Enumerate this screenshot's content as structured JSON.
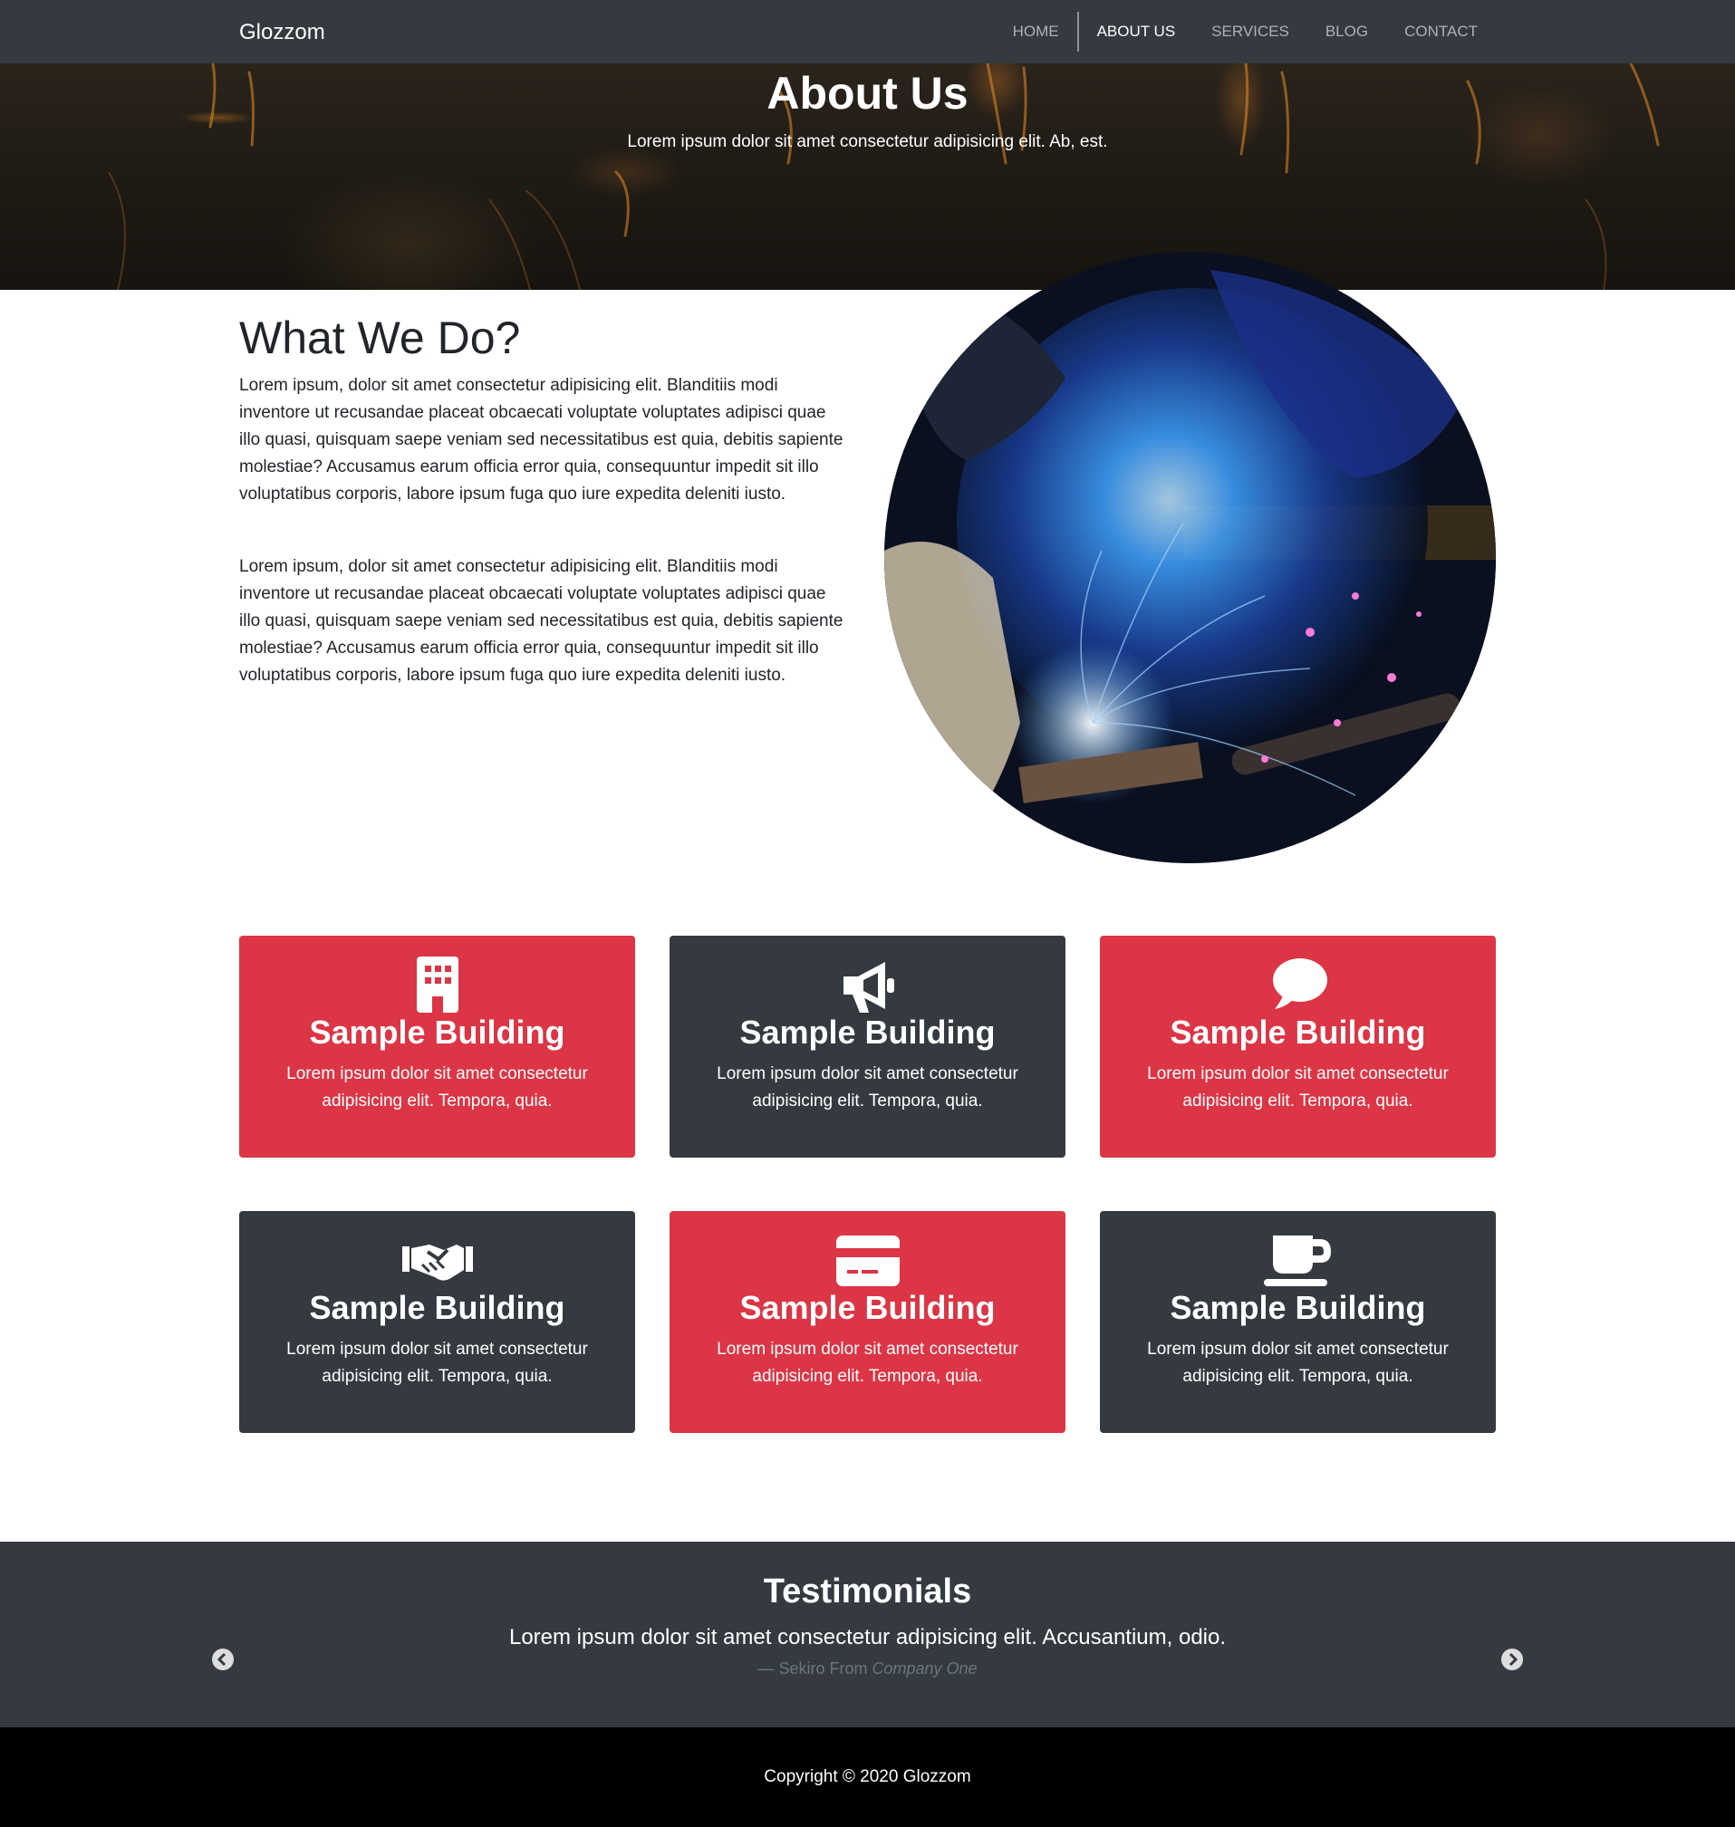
{
  "navbar": {
    "brand": "Glozzom",
    "links": [
      {
        "label": "HOME"
      },
      {
        "label": "ABOUT US"
      },
      {
        "label": "SERVICES"
      },
      {
        "label": "BLOG"
      },
      {
        "label": "CONTACT"
      }
    ]
  },
  "hero": {
    "title": "About Us",
    "subtitle": "Lorem ipsum dolor sit amet consectetur adipisicing elit. Ab, est."
  },
  "about": {
    "title": "What We Do?",
    "paragraphs": [
      "Lorem ipsum, dolor sit amet consectetur adipisicing elit. Blanditiis modi inventore ut recusandae placeat obcaecati voluptate voluptates adipisci quae illo quasi, quisquam saepe veniam sed necessitatibus est quia, debitis sapiente molestiae? Accusamus earum officia error quia, consequuntur impedit sit illo voluptatibus corporis, labore ipsum fuga quo iure expedita deleniti iusto.",
      "Lorem ipsum, dolor sit amet consectetur adipisicing elit. Blanditiis modi inventore ut recusandae placeat obcaecati voluptate voluptates adipisci quae illo quasi, quisquam saepe veniam sed necessitatibus est quia, debitis sapiente molestiae? Accusamus earum officia error quia, consequuntur impedit sit illo voluptatibus corporis, labore ipsum fuga quo iure expedita deleniti iusto."
    ]
  },
  "cards": [
    {
      "icon": "building-icon",
      "title": "Sample Building",
      "text": "Lorem ipsum dolor sit amet consectetur adipisicing elit. Tempora, quia.",
      "color": "#dc3545"
    },
    {
      "icon": "bullhorn-icon",
      "title": "Sample Building",
      "text": "Lorem ipsum dolor sit amet consectetur adipisicing elit. Tempora, quia.",
      "color": "#343a40"
    },
    {
      "icon": "comment-icon",
      "title": "Sample Building",
      "text": "Lorem ipsum dolor sit amet consectetur adipisicing elit. Tempora, quia.",
      "color": "#dc3545"
    },
    {
      "icon": "handshake-icon",
      "title": "Sample Building",
      "text": "Lorem ipsum dolor sit amet consectetur adipisicing elit. Tempora, quia.",
      "color": "#343a40"
    },
    {
      "icon": "credit-card-icon",
      "title": "Sample Building",
      "text": "Lorem ipsum dolor sit amet consectetur adipisicing elit. Tempora, quia.",
      "color": "#dc3545"
    },
    {
      "icon": "coffee-icon",
      "title": "Sample Building",
      "text": "Lorem ipsum dolor sit amet consectetur adipisicing elit. Tempora, quia.",
      "color": "#343a40"
    }
  ],
  "testimonials": {
    "title": "Testimonials",
    "quote": "Lorem ipsum dolor sit amet consectetur adipisicing elit. Accusantium, odio.",
    "author": "— Sekiro From",
    "company": "Company One"
  },
  "footer": {
    "copyright": "Copyright © 2020 Glozzom"
  },
  "colors": {
    "navbar": "#343a40",
    "accent_red": "#dc3545",
    "dark": "#343a40",
    "footer": "#000000"
  }
}
